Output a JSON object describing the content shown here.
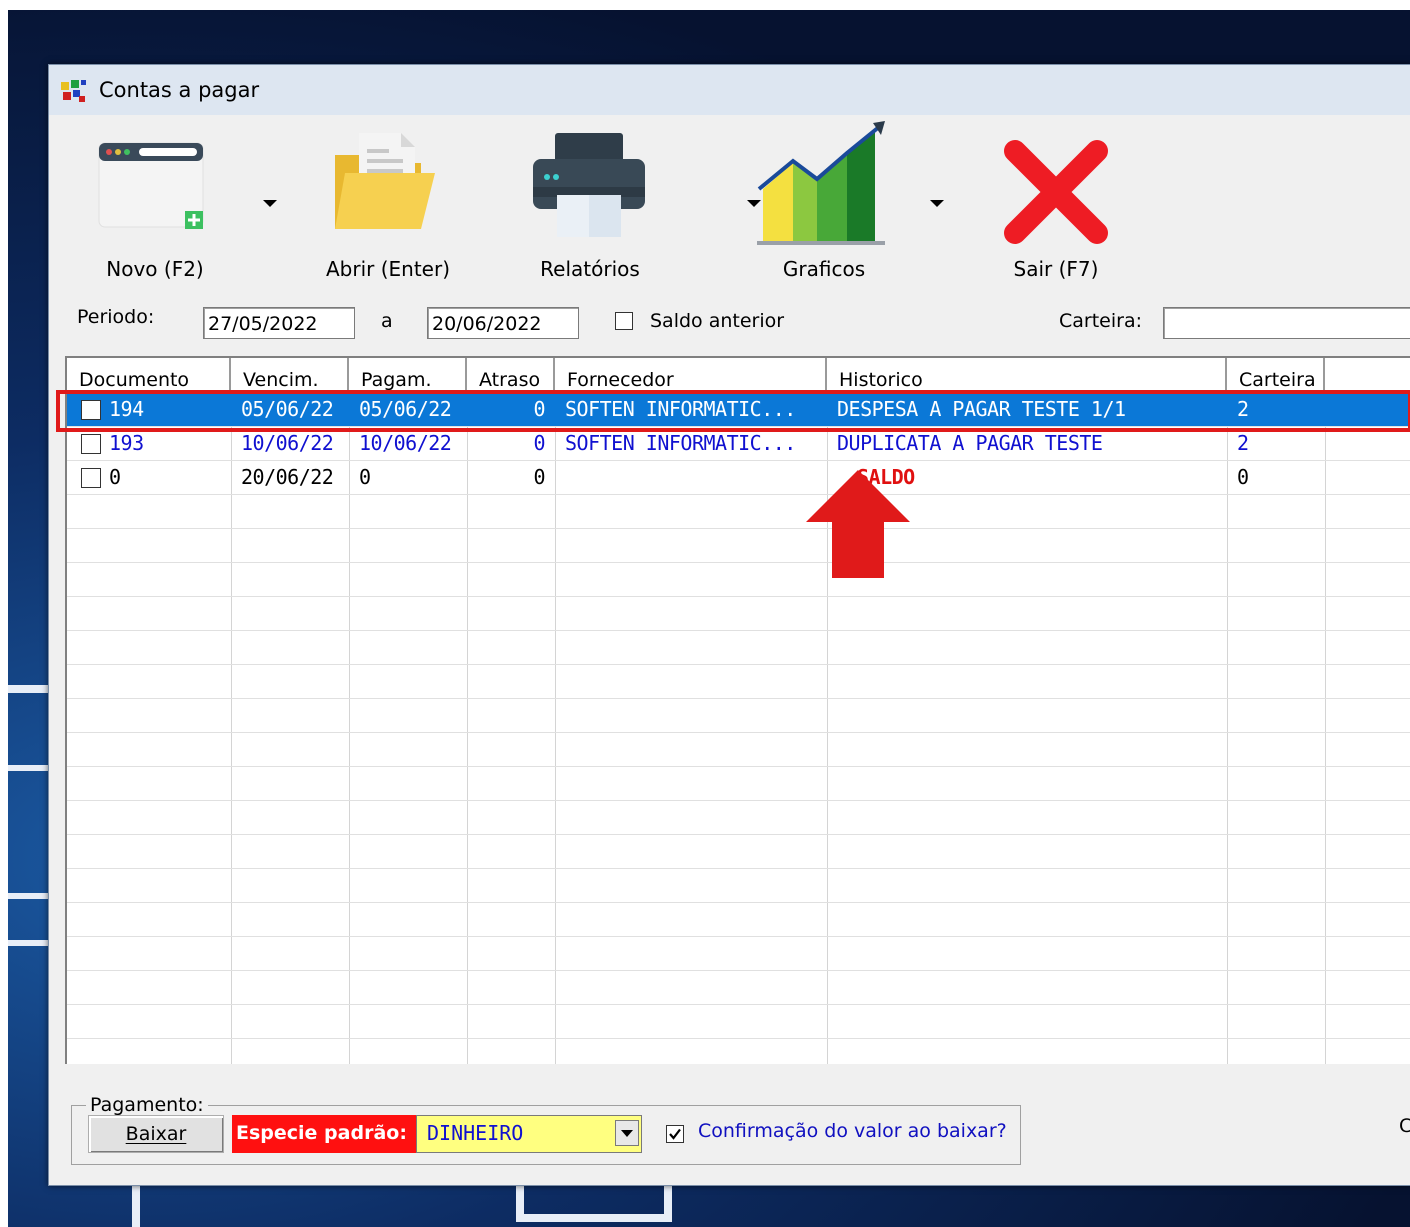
{
  "window": {
    "title": "Contas a pagar",
    "app_icon": "app-icon"
  },
  "toolbar": {
    "novo": {
      "label": "Novo (F2)",
      "icon": "new-window-icon"
    },
    "abrir": {
      "label": "Abrir (Enter)",
      "icon": "folder-icon"
    },
    "relatorios": {
      "label": "Relatórios",
      "icon": "printer-icon"
    },
    "graficos": {
      "label": "Graficos",
      "icon": "chart-icon"
    },
    "sair": {
      "label": "Sair (F7)",
      "icon": "close-icon"
    }
  },
  "filters": {
    "periodo_label": "Periodo:",
    "date_from": "27/05/2022",
    "a_label": "a",
    "date_to": "20/06/2022",
    "saldo_anterior_label": "Saldo anterior",
    "saldo_anterior_checked": false,
    "carteira_label": "Carteira:",
    "carteira_value": ""
  },
  "grid": {
    "columns": [
      "Documento",
      "Vencim.",
      "Pagam.",
      "Atraso",
      "Fornecedor",
      "Historico",
      "Carteira",
      ""
    ],
    "rows": [
      {
        "documento": "194",
        "vencim": "05/06/22",
        "pagam": "05/06/22",
        "atraso": "0",
        "fornecedor": "SOFTEN INFORMATIC...",
        "historico": "DESPESA A PAGAR TESTE 1/1",
        "carteira": "2",
        "selected": true
      },
      {
        "documento": "193",
        "vencim": "10/06/22",
        "pagam": "10/06/22",
        "atraso": "0",
        "fornecedor": "SOFTEN INFORMATIC...",
        "historico": "DUPLICATA A PAGAR TESTE",
        "carteira": "2",
        "selected": false
      },
      {
        "documento": "0",
        "vencim": "20/06/22",
        "pagam": "0",
        "atraso": "0",
        "fornecedor": "",
        "historico": "SALDO",
        "carteira": "0",
        "selected": false
      }
    ]
  },
  "payment": {
    "legend": "Pagamento:",
    "baixar_label": "Baixar",
    "especie_label": "Especie padrão:",
    "especie_value": "DINHEIRO",
    "confirmacao_label": "Confirmação do valor ao baixar?",
    "confirmacao_checked": true,
    "right_edge_text": "C"
  },
  "annotation": {
    "highlight_color": "#e01a1a",
    "arrow_color": "#e01a1a"
  },
  "colors": {
    "selection": "#0b78d7",
    "row_text_blue": "#1010d0",
    "saldo_red": "#e01010",
    "especie_bg": "#ff1010",
    "combo_bg": "#ffff80"
  }
}
